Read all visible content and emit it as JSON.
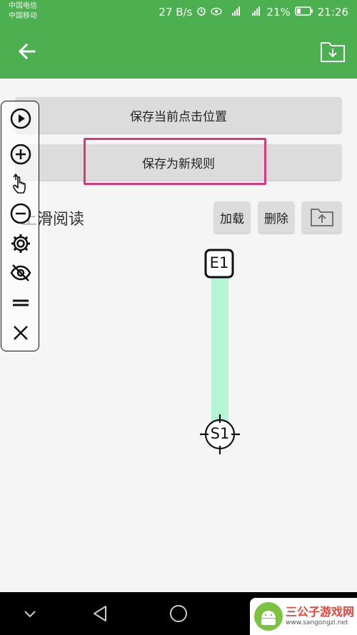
{
  "status_bar": {
    "carrier1": "中国电信",
    "carrier2": "中国移动",
    "speed": "27 B/s",
    "battery": "21%",
    "time": "21:26"
  },
  "buttons": {
    "save_position": "保存当前点击位置",
    "save_rule": "保存为新规则",
    "load": "加载",
    "delete": "删除"
  },
  "rule_name": "上滑阅读",
  "markers": {
    "end": "E1",
    "start": "S1"
  },
  "watermark": {
    "name": "三公子游戏网",
    "url": "www.sangongzi.net"
  },
  "colors": {
    "app_green": "#4caf50",
    "highlight": "#d93a7c",
    "swipe_path": "#b4f5d6"
  },
  "icons": {
    "back": "arrow-left-icon",
    "import": "folder-download-icon",
    "export": "folder-upload-icon",
    "toolbar": [
      "play-icon",
      "plus-icon",
      "swipe-hand-icon",
      "minus-icon",
      "gear-icon",
      "eye-off-icon",
      "equals-icon",
      "close-icon"
    ]
  }
}
